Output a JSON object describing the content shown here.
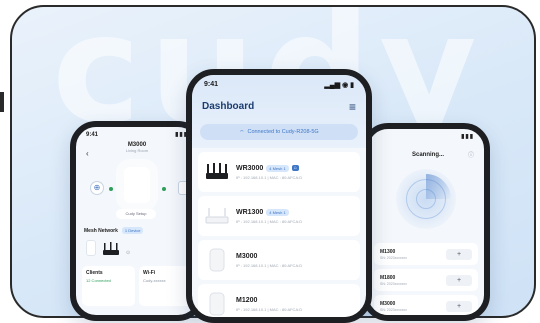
{
  "watermark": "cudy",
  "colors": {
    "accent": "#3f76c6",
    "frame": "#2a2a2a",
    "online": "#2e9f5b"
  },
  "left_phone": {
    "time": "9:41",
    "signal": "▮▮▮",
    "title": "M3000",
    "subtitle": "Living Room",
    "back_icon": "chevron-left-icon",
    "pill": "Cudy Setup",
    "section_label": "Mesh Network",
    "section_tag": "1 Device",
    "cards": [
      {
        "title": "Clients",
        "sub": "12 Connected",
        "line": ""
      },
      {
        "title": "Wi-Fi",
        "sub": "",
        "line": "Cudy-xxxxxx"
      }
    ]
  },
  "center_phone": {
    "time": "9:41",
    "signal": "▂▄▆ ◉ ▮",
    "title": "Dashboard",
    "menu_icon": "hamburger-menu-icon",
    "connected": "Connected to Cudy-R208-5G",
    "devices": [
      {
        "name": "WR3000",
        "badge": "4 Mesh 1",
        "meta": "IP : 192.168.10.1  |  MAC : 80:AFCA:D",
        "kind": "router-black"
      },
      {
        "name": "WR1300",
        "badge": "4 Mesh 1",
        "meta": "IP : 192.168.10.1  |  MAC : 80:AFCA:D",
        "kind": "router-white"
      },
      {
        "name": "M3000",
        "badge": "",
        "meta": "IP : 192.168.10.1  |  MAC : 80:AFCA:D",
        "kind": "mesh-node"
      },
      {
        "name": "M1200",
        "badge": "",
        "meta": "IP : 192.168.10.1  |  MAC : 80:AFCA:D",
        "kind": "mesh-node"
      }
    ]
  },
  "right_phone": {
    "time": "",
    "signal": "▮▮▮",
    "title": "Scanning...",
    "help_icon": "help-circle-icon",
    "devices": [
      {
        "name": "M1300",
        "sub": "SN: 2023xxxxxxx"
      },
      {
        "name": "M1800",
        "sub": "SN: 2023xxxxxxx"
      },
      {
        "name": "M3000",
        "sub": "SN: 2023xxxxxxx"
      }
    ],
    "add_label": "+"
  }
}
